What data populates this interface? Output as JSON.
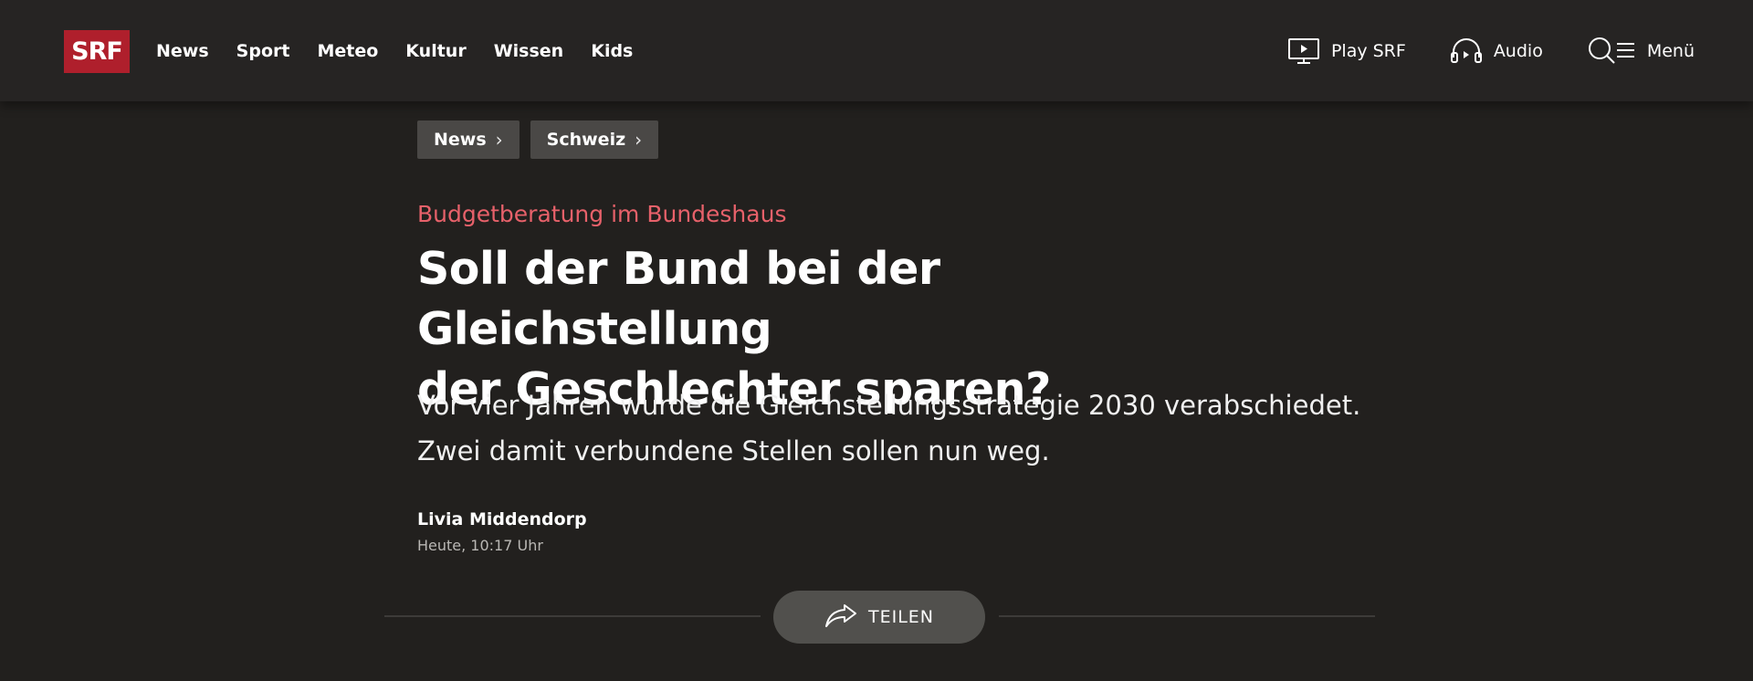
{
  "brand": {
    "logo_text": "SRF",
    "color": "#af1f2c"
  },
  "nav": {
    "main": [
      "News",
      "Sport",
      "Meteo",
      "Kultur",
      "Wissen",
      "Kids"
    ],
    "play_label": "Play SRF",
    "audio_label": "Audio",
    "menu_label": "Menü"
  },
  "breadcrumb": [
    {
      "label": "News"
    },
    {
      "label": "Schweiz"
    }
  ],
  "article": {
    "kicker": "Budgetberatung im Bundeshaus",
    "title_line1": "Soll der Bund bei der Gleichstellung",
    "title_line2": "der Geschlechter sparen?",
    "lead_line1": "Vor vier Jahren wurde die Gleichstellungsstrategie 2030 verabschiedet.",
    "lead_line2": "Zwei damit verbundene Stellen sollen nun weg.",
    "author": "Livia Middendorp",
    "date": "Heute, 10:17 Uhr"
  },
  "share": {
    "label": "TEILEN"
  },
  "colors": {
    "background": "#22201e",
    "header": "#262423",
    "kicker": "#e7616a",
    "share_button": "#51504d"
  }
}
